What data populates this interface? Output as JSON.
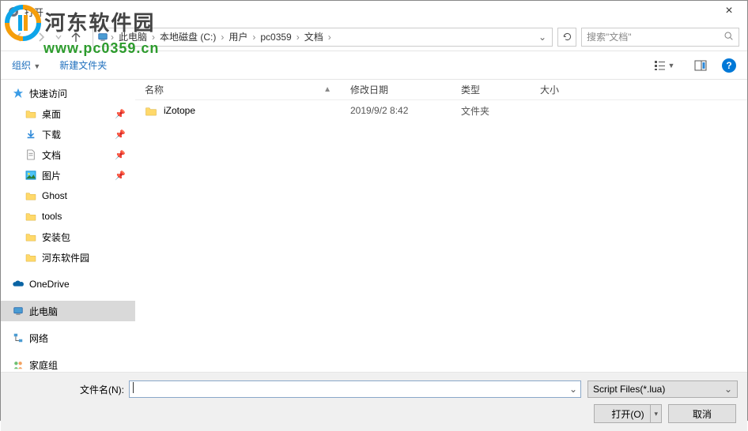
{
  "titlebar": {
    "title": "打开",
    "close": "×"
  },
  "watermark": {
    "name": "河东软件园",
    "url": "www.pc0359.cn"
  },
  "nav": {
    "breadcrumb": [
      "此电脑",
      "本地磁盘 (C:)",
      "用户",
      "pc0359",
      "文档"
    ],
    "search_placeholder": "搜索\"文档\""
  },
  "toolbar": {
    "organize": "组织",
    "newfolder": "新建文件夹"
  },
  "sidebar": {
    "quick": "快速访问",
    "desktop": "桌面",
    "downloads": "下载",
    "documents": "文档",
    "pictures": "图片",
    "ghost": "Ghost",
    "tools": "tools",
    "installers": "安装包",
    "hedong": "河东软件园",
    "onedrive": "OneDrive",
    "thispc": "此电脑",
    "network": "网络",
    "homegroup": "家庭组"
  },
  "columns": {
    "name": "名称",
    "date": "修改日期",
    "type": "类型",
    "size": "大小"
  },
  "rows": [
    {
      "name": "iZotope",
      "date": "2019/9/2 8:42",
      "type": "文件夹"
    }
  ],
  "footer": {
    "filename_label": "文件名(N):",
    "filename_value": "",
    "filter": "Script Files(*.lua)",
    "open": "打开(O)",
    "cancel": "取消"
  }
}
